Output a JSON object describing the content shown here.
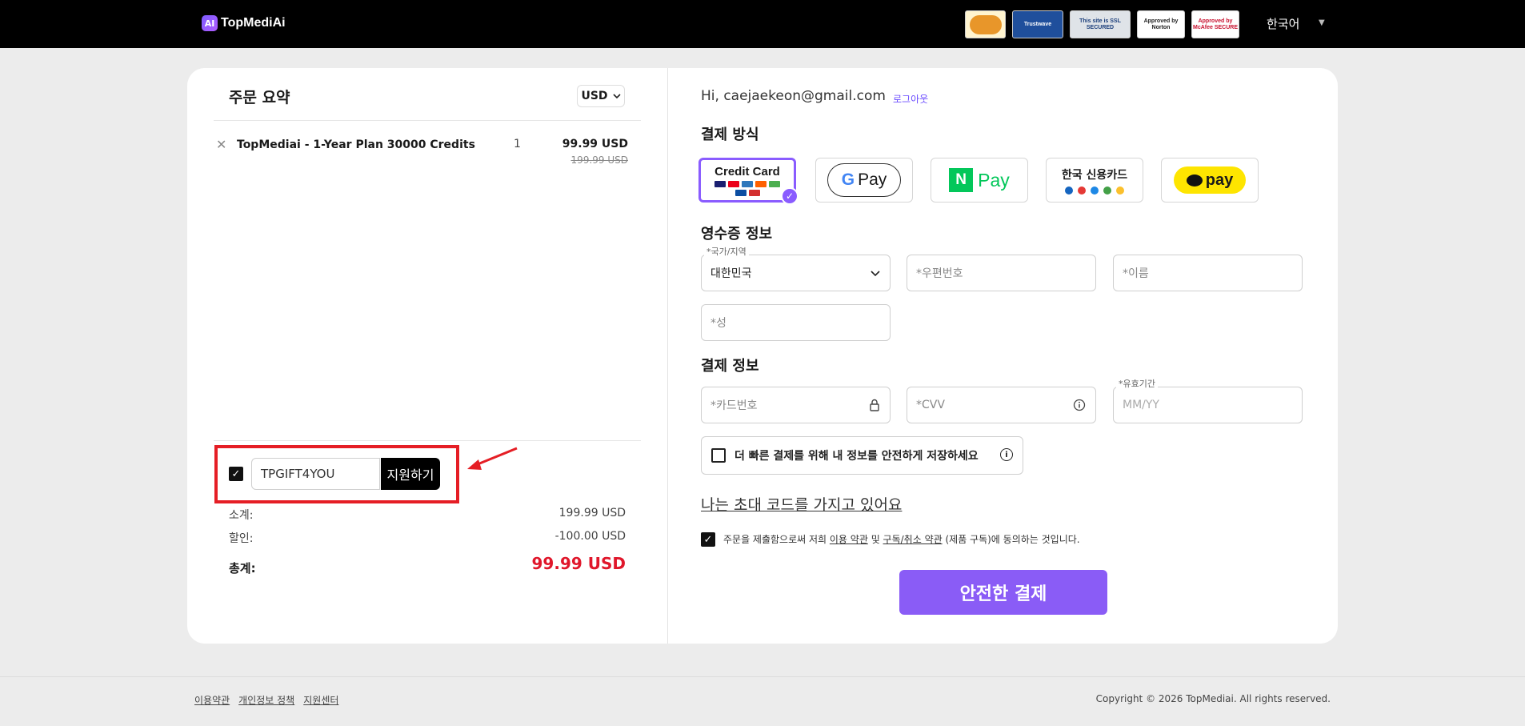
{
  "header": {
    "logo_mark": "AI",
    "logo_text": "TopMediAi",
    "badges": [
      "",
      "Trustwave",
      "This site is SSL SECURED",
      "Approved by Norton",
      "Approved by McAfee SECURE"
    ],
    "language": "한국어",
    "language_caret": "▼"
  },
  "order": {
    "title": "주문 요약",
    "currency": "USD",
    "item": {
      "remove": "✕",
      "name": "TopMediai - 1-Year Plan 30000 Credits",
      "qty": "1",
      "price": "99.99 USD",
      "old_price": "199.99 USD"
    },
    "coupon": {
      "checked": "✓",
      "code": "TPGIFT4YOU",
      "apply_label": "지원하기"
    },
    "subtotal_label": "소계:",
    "subtotal_value": "199.99 USD",
    "discount_label": "할인:",
    "discount_value": "-100.00 USD",
    "total_label": "총계:",
    "total_value": "99.99 USD"
  },
  "checkout": {
    "greeting": "Hi, caejaekeon@gmail.com",
    "logout": "로그아웃",
    "payment_method_title": "결제 방식",
    "credit_card_label": "Credit Card",
    "gpay_label": "Pay",
    "gpay_g": "G",
    "npay_label": "Pay",
    "npay_n": "N",
    "korean_card_label": "한국 신용카드",
    "kakaopay_label": "pay",
    "receipt_title": "영수증 정보",
    "country_label": "*국가/지역",
    "country_value": "대한민국",
    "postal_placeholder": "*우편번호",
    "firstname_placeholder": "*이름",
    "lastname_placeholder": "*성",
    "payment_info_title": "결제 정보",
    "card_number_placeholder": "*카드번호",
    "cvv_placeholder": "*CVV",
    "expiry_label": "*유효기간",
    "expiry_placeholder": "MM/YY",
    "save_info_label": "더 빠른 결제를 위해 내 정보를 안전하게 저장하세요",
    "invite_code": "나는 초대 코드를 가지고 있어요",
    "terms_pre": "주문을 제출함으로써 저희 ",
    "terms_link1": "이용 약관",
    "terms_mid": " 및 ",
    "terms_link2": "구독/취소 약관",
    "terms_post": " (제품 구독)에 동의하는 것입니다.",
    "pay_button": "안전한 결제"
  },
  "footer": {
    "links": [
      "이용약관",
      "개인정보 정책",
      "지원센터"
    ],
    "copyright": "Copyright © 2026 TopMediai. All rights reserved."
  },
  "colors": {
    "accent": "#8a5cf6",
    "highlight_box": "#e51e25",
    "total_price": "#e0172b"
  }
}
